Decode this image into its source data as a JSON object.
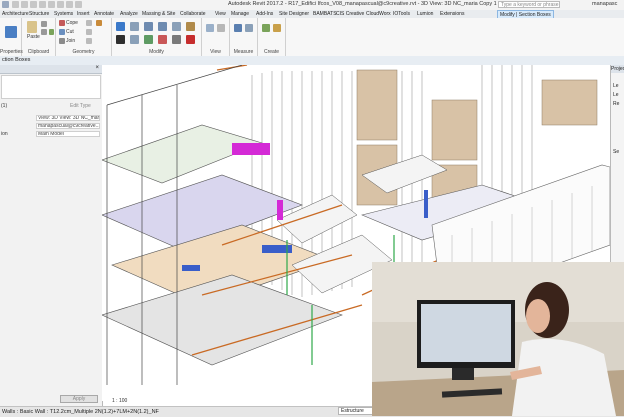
{
  "titlebar": {
    "window_title": "Autodesk Revit 2017.2 -    R17_Edifici Ifcos_V08_manapascual@c9creative.rvt - 3D View: 3D NC_maria Copy 1",
    "search_placeholder": "Type a keyword or phrase",
    "user": "manapasc"
  },
  "tabs": [
    "Architecture",
    "Structure",
    "Systems",
    "Insert",
    "Annotate",
    "Analyze",
    "Massing & Site",
    "Collaborate",
    "View",
    "Manage",
    "Add-Ins",
    "Site Designer",
    "BAMBATS",
    "CIS Creative",
    "CloudWorx",
    "IOTools",
    "Lumion",
    "Extensions",
    "Modify | Section Boxes"
  ],
  "ribbon": {
    "groups": [
      "Properties",
      "Clipboard",
      "Geometry",
      "Modify",
      "View",
      "Measure",
      "Create"
    ],
    "clipboard_paste": "Paste",
    "geometry_items": [
      "Cope",
      "Cut",
      "Join"
    ]
  },
  "options_bar": {
    "text": "ction Boxes"
  },
  "properties": {
    "type_selector": "(1)",
    "edit_type": "Edit Type",
    "rows": [
      {
        "key": "",
        "value": "View: 3D View: 3D NC_mar..."
      },
      {
        "key": "",
        "value": "manapascual@c9creative..."
      },
      {
        "key": "ion",
        "value": "Main Model"
      }
    ],
    "apply_label": "Apply"
  },
  "browser": {
    "title": "Project Browser - R",
    "tree_items": [
      "Le",
      "Le",
      "Re",
      "Se"
    ]
  },
  "viewport": {
    "scale": "1 : 100"
  },
  "statusbar": {
    "text": "Walls : Basic Wall : T12.2cm_Multiple 2N(1.2)+7LM+2N(1.2)_NF",
    "type_combo": "Estructure"
  },
  "colors": {
    "ribbon_accent": "#d7eafb",
    "selection_magenta": "#d42ad6",
    "wall_orange": "#c96a24",
    "panel_blue": "#3a5ec9",
    "green_accent": "#2fa84a"
  },
  "icons": [
    "properties-icon",
    "paste-icon",
    "cope-icon",
    "cut-icon",
    "join-icon",
    "move-icon",
    "copy-icon",
    "rotate-icon",
    "mirror-icon",
    "trim-icon",
    "array-icon",
    "scale-icon",
    "pin-icon",
    "delete-icon",
    "view-icon",
    "measure-icon",
    "create-icon",
    "close-icon"
  ]
}
